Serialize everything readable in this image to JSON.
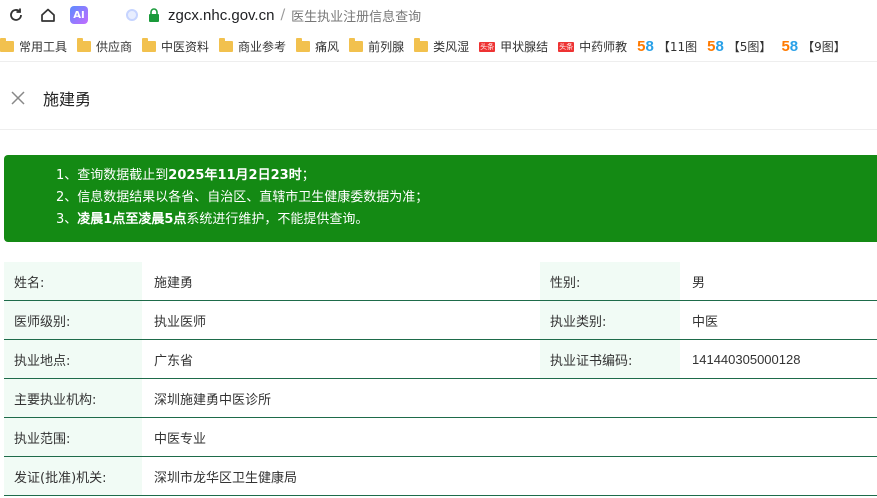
{
  "browser": {
    "url_host": "zgcx.nhc.gov.cn",
    "url_separator": "/",
    "page_title": "医生执业注册信息查询",
    "ai_label": "AI"
  },
  "bookmarks": [
    {
      "label": "常用工具",
      "icon": "folder-icon"
    },
    {
      "label": "供应商",
      "icon": "folder-icon"
    },
    {
      "label": "中医资料",
      "icon": "folder-icon"
    },
    {
      "label": "商业参考",
      "icon": "folder-icon"
    },
    {
      "label": "痛风",
      "icon": "folder-icon"
    },
    {
      "label": "前列腺",
      "icon": "folder-icon"
    },
    {
      "label": "类风湿",
      "icon": "folder-icon"
    },
    {
      "label": "甲状腺结",
      "icon": "toutiao-icon"
    },
    {
      "label": "中药师教",
      "icon": "toutiao-icon"
    },
    {
      "label": "【11图",
      "icon": "58-icon"
    },
    {
      "label": "【5图】",
      "icon": "58-icon"
    },
    {
      "label": "【9图】",
      "icon": "58-icon"
    }
  ],
  "icon_text": {
    "toutiao": "头条",
    "n5": "5",
    "n8": "8"
  },
  "header": {
    "title": "施建勇"
  },
  "notice": {
    "line1_prefix": "1、查询数据截止到",
    "line1_bold": "2025年11月2日23时",
    "line1_suffix": "；",
    "line2": "2、信息数据结果以各省、自治区、直辖市卫生健康委数据为准；",
    "line3_prefix": "3、",
    "line3_bold": "凌晨1点至凌晨5点",
    "line3_suffix": "系统进行维护，不能提供查询。"
  },
  "info": {
    "name_label": "姓名:",
    "name_value": "施建勇",
    "gender_label": "性别:",
    "gender_value": "男",
    "level_label": "医师级别:",
    "level_value": "执业医师",
    "category_label": "执业类别:",
    "category_value": "中医",
    "location_label": "执业地点:",
    "location_value": "广东省",
    "cert_label": "执业证书编码:",
    "cert_value": "141440305000128",
    "org_label": "主要执业机构:",
    "org_value": "深圳施建勇中医诊所",
    "scope_label": "执业范围:",
    "scope_value": "中医专业",
    "issuer_label": "发证(批准)机关:",
    "issuer_value": "深圳市龙华区卫生健康局"
  },
  "colors": {
    "notice_bg": "#148a14",
    "label_bg": "#f1fbf5",
    "row_border": "#1e6b4a"
  }
}
